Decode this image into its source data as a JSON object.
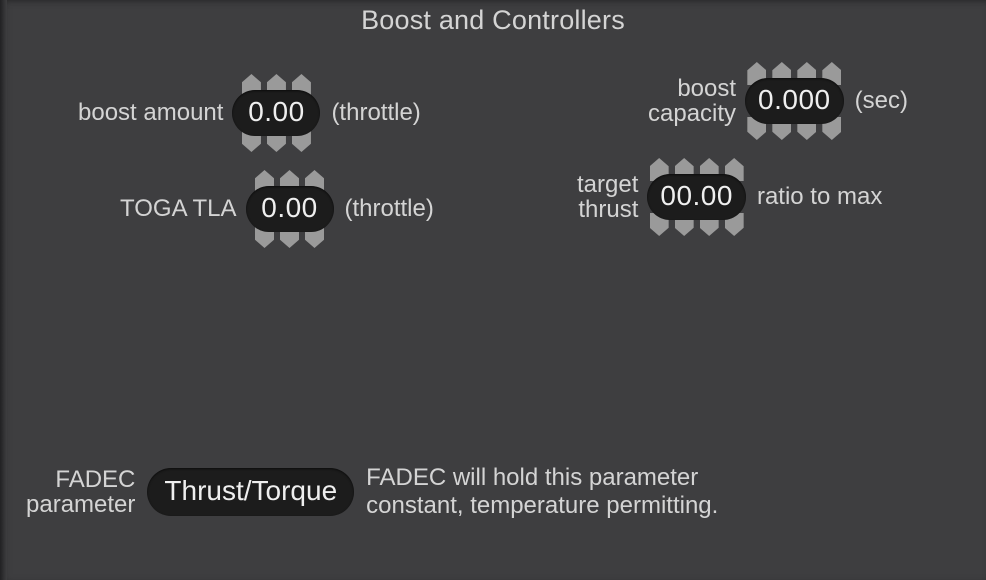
{
  "panel": {
    "title": "Boost and Controllers",
    "background_color": "#3e3e40",
    "text_color": "#d4d4d4",
    "value_background_color": "#1c1c1c",
    "arrow_color": "#9a9a9a"
  },
  "controls": [
    {
      "name": "boost-amount",
      "label": "boost amount",
      "value": "0.00",
      "unit": "(throttle)",
      "digits": 3
    },
    {
      "name": "boost-capacity",
      "label": "boost\ncapacity",
      "value": "0.000",
      "unit": "(sec)",
      "digits": 4
    },
    {
      "name": "toga-tla",
      "label": "TOGA TLA",
      "value": "0.00",
      "unit": "(throttle)",
      "digits": 3
    },
    {
      "name": "target-thrust",
      "label": "target\nthrust",
      "value": "00.00",
      "unit": "ratio to max",
      "digits": 4
    }
  ],
  "fadec": {
    "label": "FADEC\nparameter",
    "value": "Thrust/Torque",
    "description": "FADEC will hold this parameter\nconstant, temperature permitting."
  }
}
